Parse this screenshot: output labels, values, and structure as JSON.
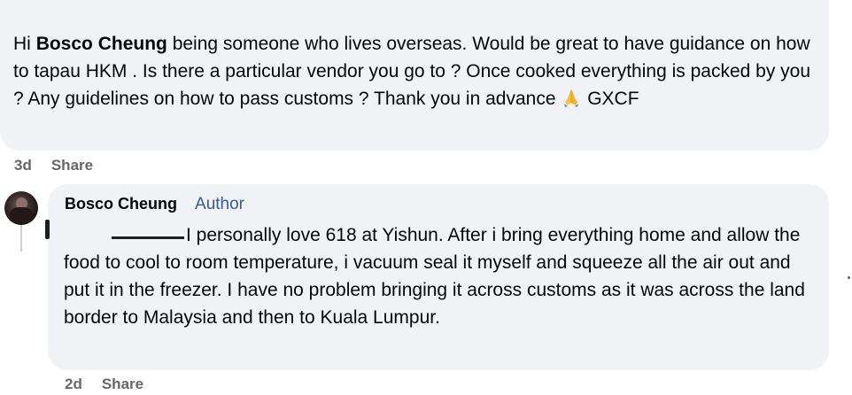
{
  "comment_1": {
    "greeting": "Hi",
    "mention": "Bosco Cheung",
    "text_after_mention": "being someone who lives overseas. Would be great to have guidance on how to tapau HKM . Is there a particular vendor you go to ? Once cooked everything is packed by you ? Any guidelines on how to pass customs ? Thank you in advance",
    "emoji": "folded-hands-emoji",
    "text_after_emoji": "GXCF",
    "time": "3d",
    "share_label": "Share"
  },
  "reply_1": {
    "author_name": "Bosco Cheung",
    "author_badge": "Author",
    "text": "I personally love 618 at Yishun. After i bring everything home and allow the food to cool to room temperature, i vacuum seal it myself and squeeze all the air out and put it in the freezer. I have no problem bringing it across customs as it was across the land border to Malaysia and then to Kuala Lumpur.",
    "time": "2d",
    "share_label": "Share"
  },
  "colors": {
    "bubble": "#f0f2f5",
    "meta_text": "#65676b",
    "author_badge": "#385898"
  }
}
